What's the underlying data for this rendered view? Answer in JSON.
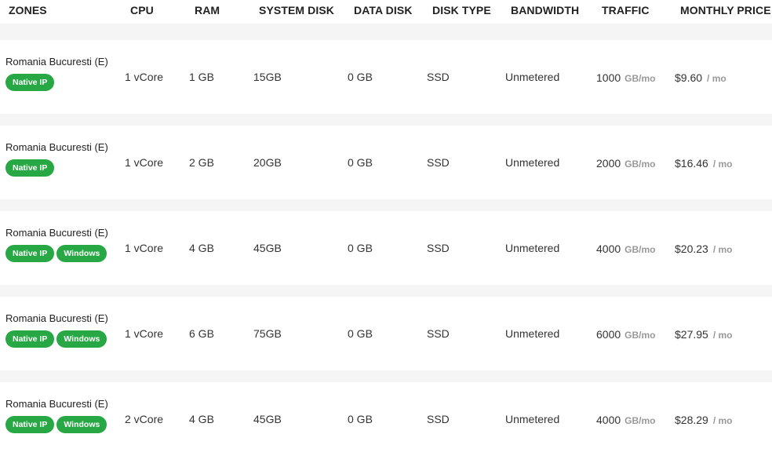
{
  "columns": {
    "zones": "ZONES",
    "cpu": "CPU",
    "ram": "RAM",
    "system_disk": "SYSTEM DISK",
    "data_disk": "DATA DISK",
    "disk_type": "DISK TYPE",
    "bandwidth": "BANDWIDTH",
    "traffic": "TRAFFIC",
    "monthly_price": "MONTHLY PRICE"
  },
  "rows": [
    {
      "zone": "Romania Bucuresti (E)",
      "badges": [
        "Native IP"
      ],
      "cpu": "1 vCore",
      "ram": "1 GB",
      "system_disk": "15GB",
      "data_disk": "0 GB",
      "disk_type": "SSD",
      "bandwidth": "Unmetered",
      "traffic": "1000",
      "traffic_unit": "GB/mo",
      "price": "$9.60",
      "price_unit": "/ mo"
    },
    {
      "zone": "Romania Bucuresti (E)",
      "badges": [
        "Native IP"
      ],
      "cpu": "1 vCore",
      "ram": "2 GB",
      "system_disk": "20GB",
      "data_disk": "0 GB",
      "disk_type": "SSD",
      "bandwidth": "Unmetered",
      "traffic": "2000",
      "traffic_unit": "GB/mo",
      "price": "$16.46",
      "price_unit": "/ mo"
    },
    {
      "zone": "Romania Bucuresti (E)",
      "badges": [
        "Native IP",
        "Windows"
      ],
      "cpu": "1 vCore",
      "ram": "4 GB",
      "system_disk": "45GB",
      "data_disk": "0 GB",
      "disk_type": "SSD",
      "bandwidth": "Unmetered",
      "traffic": "4000",
      "traffic_unit": "GB/mo",
      "price": "$20.23",
      "price_unit": "/ mo"
    },
    {
      "zone": "Romania Bucuresti (E)",
      "badges": [
        "Native IP",
        "Windows"
      ],
      "cpu": "1 vCore",
      "ram": "6 GB",
      "system_disk": "75GB",
      "data_disk": "0 GB",
      "disk_type": "SSD",
      "bandwidth": "Unmetered",
      "traffic": "6000",
      "traffic_unit": "GB/mo",
      "price": "$27.95",
      "price_unit": "/ mo"
    },
    {
      "zone": "Romania Bucuresti (E)",
      "badges": [
        "Native IP",
        "Windows"
      ],
      "cpu": "2 vCore",
      "ram": "4 GB",
      "system_disk": "45GB",
      "data_disk": "0 GB",
      "disk_type": "SSD",
      "bandwidth": "Unmetered",
      "traffic": "4000",
      "traffic_unit": "GB/mo",
      "price": "$28.29",
      "price_unit": "/ mo"
    }
  ],
  "colors": {
    "badge_bg": "#27a844",
    "row_bg": "#ffffff",
    "page_bg": "#f5f5f5",
    "muted_unit": "#999999"
  }
}
